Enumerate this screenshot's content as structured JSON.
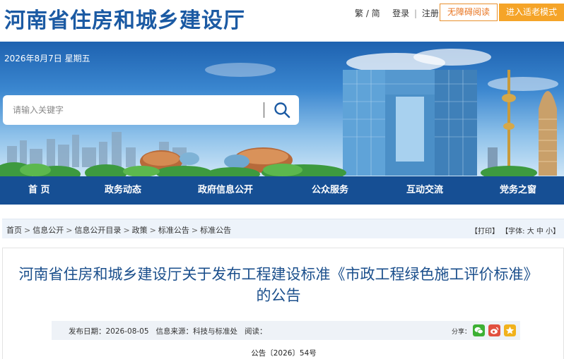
{
  "header": {
    "site_title": "河南省住房和城乡建设厅",
    "lang_toggle": "繁 / 简",
    "login": "登录",
    "register": "注册",
    "accessibility_button": "无障碍阅读",
    "elderly_mode_button": "进入适老模式"
  },
  "banner": {
    "date": "2026年8月7日 星期五",
    "search_placeholder": "请输入关键字"
  },
  "nav": {
    "items": [
      "首 页",
      "政务动态",
      "政府信息公开",
      "公众服务",
      "互动交流",
      "党务之窗"
    ]
  },
  "breadcrumb": {
    "items": [
      "首页",
      "信息公开",
      "信息公开目录",
      "政策",
      "标准公告",
      "标准公告"
    ]
  },
  "tools": {
    "print": "【打印】",
    "font_prefix": "【字体:",
    "large": "大",
    "medium": "中",
    "small": "小",
    "font_suffix": "】"
  },
  "article": {
    "title": "河南省住房和城乡建设厅关于发布工程建设标准《市政工程绿色施工评价标准》的公告",
    "publish_date_label": "发布日期：",
    "publish_date": "2026-08-05",
    "source_label": "信息来源：",
    "source": "科技与标准处",
    "reads_label": "阅读：",
    "share_label": "分享：",
    "notice_number": "公告〔2026〕54号"
  },
  "colors": {
    "brand_blue": "#1b5aa3",
    "nav_blue": "#164f94",
    "orange": "#f5a428",
    "wechat_green": "#3cb034",
    "weibo_red": "#e2503f",
    "favorite_yellow": "#f1b21d"
  },
  "icons": [
    "search-icon",
    "wechat-icon",
    "weibo-icon",
    "favorite-icon"
  ]
}
